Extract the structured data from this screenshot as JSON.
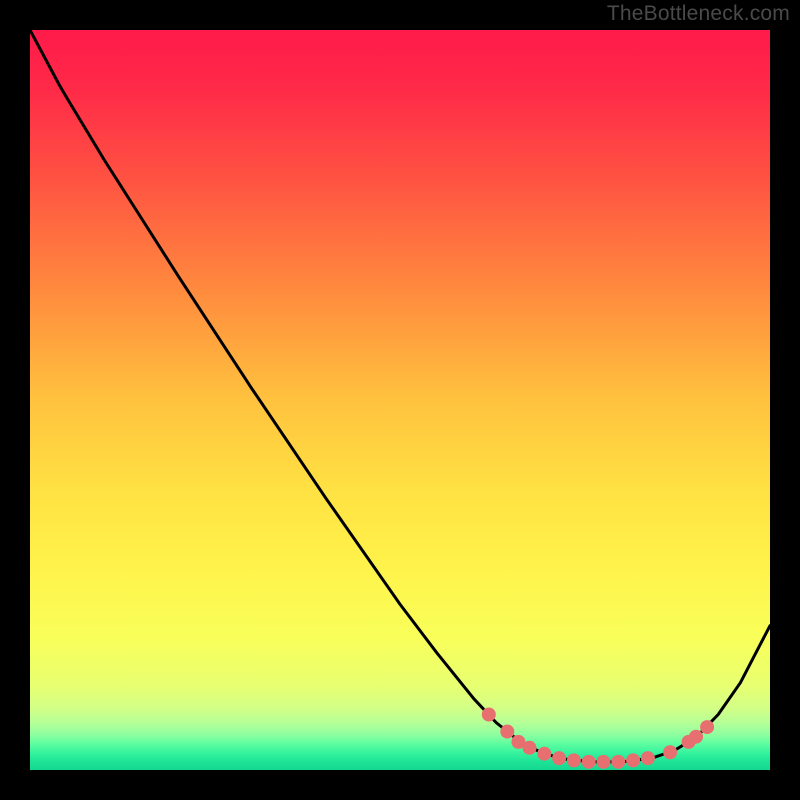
{
  "watermark": "TheBottleneck.com",
  "chart_data": {
    "type": "line",
    "title": "",
    "xlabel": "",
    "ylabel": "",
    "xlim": [
      0,
      100
    ],
    "ylim": [
      0,
      100
    ],
    "gradient_stops": [
      {
        "offset": 0.0,
        "color": "#ff1a4a"
      },
      {
        "offset": 0.08,
        "color": "#ff2a48"
      },
      {
        "offset": 0.2,
        "color": "#ff5242"
      },
      {
        "offset": 0.35,
        "color": "#ff8a3e"
      },
      {
        "offset": 0.5,
        "color": "#ffc23e"
      },
      {
        "offset": 0.62,
        "color": "#ffe143"
      },
      {
        "offset": 0.72,
        "color": "#fff24a"
      },
      {
        "offset": 0.82,
        "color": "#f9ff59"
      },
      {
        "offset": 0.885,
        "color": "#e8ff70"
      },
      {
        "offset": 0.915,
        "color": "#d4ff85"
      },
      {
        "offset": 0.935,
        "color": "#b8ff96"
      },
      {
        "offset": 0.952,
        "color": "#8effa0"
      },
      {
        "offset": 0.965,
        "color": "#5cfda0"
      },
      {
        "offset": 0.978,
        "color": "#33f29d"
      },
      {
        "offset": 0.988,
        "color": "#1ee497"
      },
      {
        "offset": 1.0,
        "color": "#14d890"
      }
    ],
    "series": [
      {
        "name": "curve",
        "color": "#000000",
        "width": 3,
        "points": [
          {
            "x": 0.0,
            "y": 100.0
          },
          {
            "x": 4.0,
            "y": 92.5
          },
          {
            "x": 5.0,
            "y": 90.8
          },
          {
            "x": 10.0,
            "y": 82.5
          },
          {
            "x": 20.0,
            "y": 66.8
          },
          {
            "x": 30.0,
            "y": 51.5
          },
          {
            "x": 40.0,
            "y": 36.7
          },
          {
            "x": 50.0,
            "y": 22.4
          },
          {
            "x": 55.0,
            "y": 15.8
          },
          {
            "x": 60.0,
            "y": 9.6
          },
          {
            "x": 63.0,
            "y": 6.4
          },
          {
            "x": 66.0,
            "y": 4.0
          },
          {
            "x": 69.0,
            "y": 2.4
          },
          {
            "x": 72.0,
            "y": 1.5
          },
          {
            "x": 76.0,
            "y": 1.1
          },
          {
            "x": 80.0,
            "y": 1.1
          },
          {
            "x": 84.0,
            "y": 1.6
          },
          {
            "x": 87.0,
            "y": 2.6
          },
          {
            "x": 90.0,
            "y": 4.4
          },
          {
            "x": 93.0,
            "y": 7.5
          },
          {
            "x": 96.0,
            "y": 11.8
          },
          {
            "x": 100.0,
            "y": 19.5
          }
        ]
      }
    ],
    "markers": {
      "color": "#e86f6f",
      "radius": 7,
      "points": [
        {
          "x": 62.0,
          "y": 7.5
        },
        {
          "x": 64.5,
          "y": 5.2
        },
        {
          "x": 66.0,
          "y": 3.8
        },
        {
          "x": 67.5,
          "y": 3.0
        },
        {
          "x": 69.5,
          "y": 2.2
        },
        {
          "x": 71.5,
          "y": 1.6
        },
        {
          "x": 73.5,
          "y": 1.3
        },
        {
          "x": 75.5,
          "y": 1.1
        },
        {
          "x": 77.5,
          "y": 1.1
        },
        {
          "x": 79.5,
          "y": 1.1
        },
        {
          "x": 81.5,
          "y": 1.3
        },
        {
          "x": 83.5,
          "y": 1.6
        },
        {
          "x": 86.5,
          "y": 2.4
        },
        {
          "x": 89.0,
          "y": 3.8
        },
        {
          "x": 90.0,
          "y": 4.5
        },
        {
          "x": 91.5,
          "y": 5.8
        }
      ]
    }
  }
}
